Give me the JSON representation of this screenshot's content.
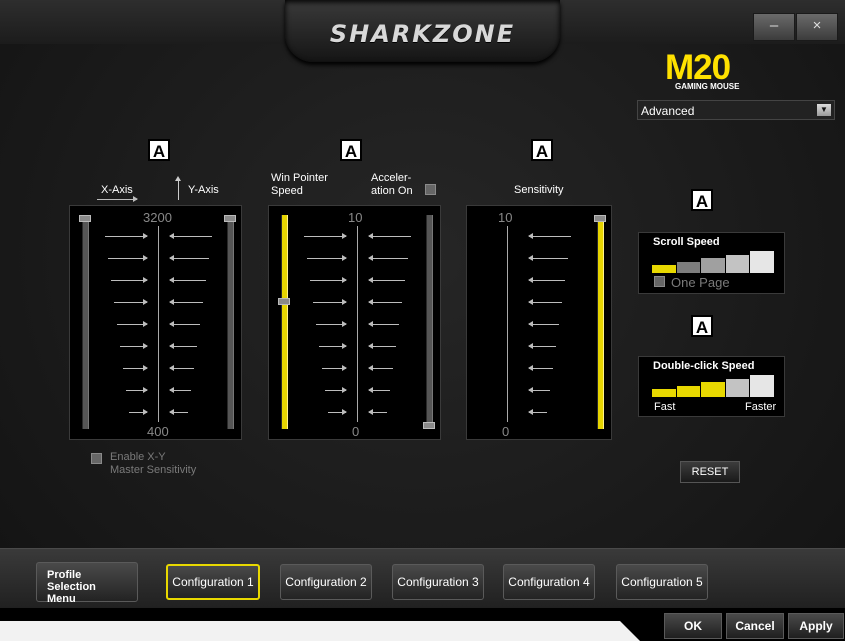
{
  "window": {
    "brand": "SHARKZONE",
    "minimize_label": "–",
    "close_label": "×"
  },
  "product": {
    "model": "M20",
    "subtitle": "GAMING MOUSE",
    "mode_selected": "Advanced"
  },
  "badges": [
    "A",
    "A",
    "A",
    "A",
    "A"
  ],
  "xy_panel": {
    "x_axis_label": "X-Axis",
    "y_axis_label": "Y-Axis",
    "max_label": "3200",
    "min_label": "400",
    "x_value_fraction": 1.0,
    "y_value_fraction": 1.0,
    "enable_label_line1": "Enable X-Y",
    "enable_label_line2": "Master Sensitivity",
    "enable_checked": false
  },
  "pointer_panel": {
    "speed_label_line1": "Win Pointer",
    "speed_label_line2": "Speed",
    "accel_label_line1": "Acceler-",
    "accel_label_line2": "ation On",
    "accel_checked": false,
    "max_label": "10",
    "min_label": "0",
    "speed_value": 6,
    "accel_value": 0
  },
  "sensitivity_panel": {
    "label": "Sensitivity",
    "max_label": "10",
    "min_label": "0",
    "value": 10
  },
  "scroll_speed": {
    "label": "Scroll Speed",
    "level": 1,
    "segments": 5,
    "one_page_label": "One Page",
    "one_page_checked": false
  },
  "double_click": {
    "label": "Double-click Speed",
    "level": 3,
    "segments": 5,
    "slow_label": "Fast",
    "fast_label": "Faster"
  },
  "reset_label": "RESET",
  "profile_menu_label_line1": "Profile Selection",
  "profile_menu_label_line2": "Menu",
  "configurations": [
    "Configuration 1",
    "Configuration 2",
    "Configuration 3",
    "Configuration 4",
    "Configuration 5"
  ],
  "active_configuration": 0,
  "footer": {
    "ok_label": "OK",
    "cancel_label": "Cancel",
    "apply_label": "Apply"
  },
  "colors": {
    "accent": "#e8d800",
    "model_yellow": "#ffe100"
  }
}
